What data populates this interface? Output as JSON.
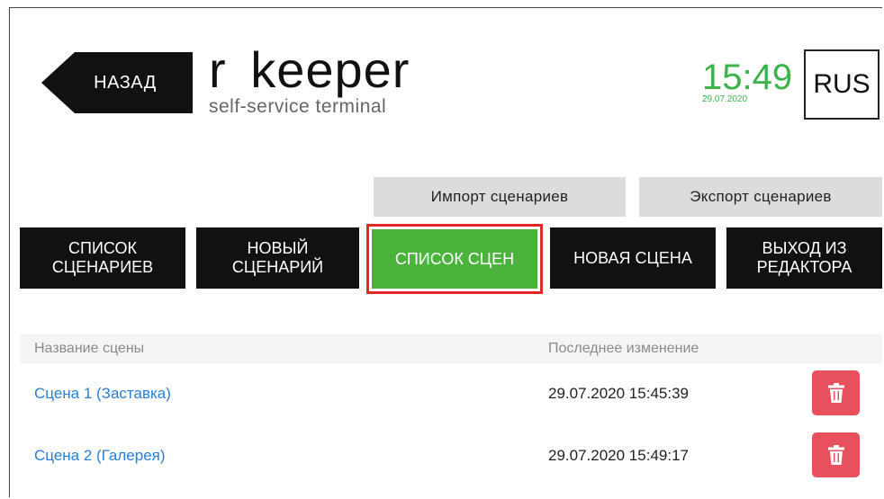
{
  "header": {
    "back_label": "НАЗАД",
    "brand_name": "r keeper",
    "brand_subtitle": "self-service terminal",
    "time": "15:49",
    "date": "29.07.2020",
    "language": "RUS"
  },
  "actions": {
    "import_label": "Импорт сценариев",
    "export_label": "Экспорт сценариев"
  },
  "nav": {
    "items": [
      {
        "label": "СПИСОК\nСЦЕНАРИЕВ",
        "active": false
      },
      {
        "label": "НОВЫЙ\nСЦЕНАРИЙ",
        "active": false
      },
      {
        "label": "СПИСОК СЦЕН",
        "active": true
      },
      {
        "label": "НОВАЯ СЦЕНА",
        "active": false
      },
      {
        "label": "ВЫХОД ИЗ\nРЕДАКТОРА",
        "active": false
      }
    ]
  },
  "table": {
    "columns": [
      "Название сцены",
      "Последнее изменение"
    ],
    "rows": [
      {
        "name": "Сцена 1 (Заставка)",
        "changed": "29.07.2020 15:45:39"
      },
      {
        "name": "Сцена 2 (Галерея)",
        "changed": "29.07.2020 15:49:17"
      }
    ]
  },
  "colors": {
    "accent_green": "#4bb33c",
    "clock_green": "#3bb34a",
    "highlight_red": "#e32626",
    "delete_red": "#e8505e",
    "link_blue": "#2a7fd4"
  },
  "icons": {
    "back": "arrow-left-icon",
    "delete": "trash-icon"
  }
}
